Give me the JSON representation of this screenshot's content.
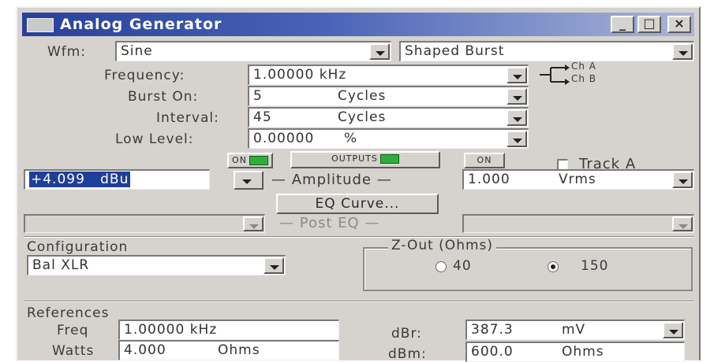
{
  "window": {
    "title": "Analog Generator",
    "minimize": "_",
    "maximize": "□",
    "close": "×"
  },
  "waveform": {
    "label": "Wfm:",
    "value": "Sine",
    "mode": "Shaped Burst"
  },
  "params": {
    "frequency_label": "Frequency:",
    "frequency_value": "1.00000 kHz",
    "burst_label": "Burst On:",
    "burst_count": "5",
    "burst_unit": "Cycles",
    "interval_label": "Interval:",
    "interval_count": "45",
    "interval_unit": "Cycles",
    "low_level_label": "Low Level:",
    "low_level_value": "0.00000",
    "low_level_unit": "%"
  },
  "channels": {
    "ch_a": "Ch A",
    "ch_b": "Ch B"
  },
  "outputs": {
    "left_btn": "ON",
    "center_btn": "OUTPUTS",
    "right_btn": "ON",
    "track_label": "Track A",
    "track_checked": false
  },
  "amplitude": {
    "left_value": "+4.099",
    "left_unit": "dBu",
    "label": "Amplitude",
    "right_value": "1.000",
    "right_unit": "Vrms"
  },
  "eq": {
    "button": "EQ Curve...",
    "post_eq_label": "Post EQ"
  },
  "configuration": {
    "label": "Configuration",
    "value": "Bal XLR"
  },
  "zout": {
    "label": "Z-Out (Ohms)",
    "option_1": "40",
    "option_2": "150",
    "selected": "150"
  },
  "references": {
    "label": "References",
    "freq_label": "Freq",
    "freq_value": "1.00000 kHz",
    "watts_label": "Watts",
    "watts_value": "4.000",
    "watts_unit": "Ohms",
    "dbr_label": "dBr:",
    "dbr_value": "387.3",
    "dbr_unit": "mV",
    "dbm_label": "dBm:",
    "dbm_value": "600.0",
    "dbm_unit": "Ohms"
  },
  "colors": {
    "title_bar": "#27409a",
    "led_on": "#2fae3c",
    "selection": "#1f3e9a",
    "panel": "#d6d3ce"
  }
}
